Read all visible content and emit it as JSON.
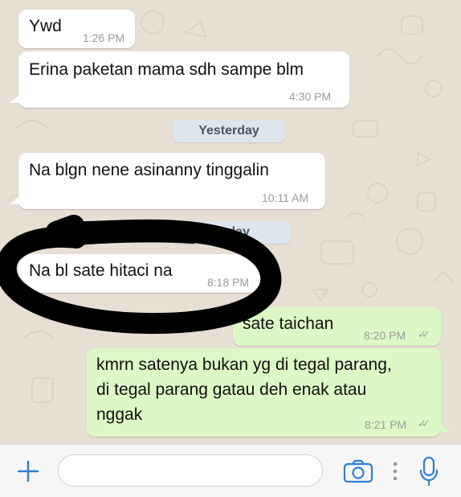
{
  "messages": [
    {
      "direction": "incoming",
      "text": "Ywd",
      "time": "1:26 PM"
    },
    {
      "direction": "incoming",
      "text": "Erina paketan mama sdh sampe blm",
      "time": "4:30 PM"
    },
    {
      "direction": "incoming",
      "text": "Na blgn nene asinanny tinggalin",
      "time": "10:11 AM"
    },
    {
      "direction": "incoming",
      "text": "Na bl sate hitaci na",
      "time": "8:18 PM"
    },
    {
      "direction": "outgoing",
      "text": "sate taichan",
      "time": "8:20 PM",
      "status": "read"
    },
    {
      "direction": "outgoing",
      "text": "kmrn satenya bukan yg di tegal parang,\ndi tegal parang gatau deh enak atau\nnggak",
      "time": "8:21 PM",
      "status": "read"
    }
  ],
  "date_separators": [
    {
      "label": "Yesterday"
    },
    {
      "label": "Today"
    }
  ],
  "composer": {
    "input_value": "",
    "icons": [
      "plus-icon",
      "camera-icon",
      "more-dots-icon",
      "microphone-icon"
    ]
  },
  "colors": {
    "incoming_bubble": "#ffffff",
    "outgoing_bubble": "#dcf8c6",
    "wallpaper": "#e7ded4",
    "accent": "#2f7ed8",
    "tick": "#9a9a9a",
    "scribble": "#000000"
  }
}
